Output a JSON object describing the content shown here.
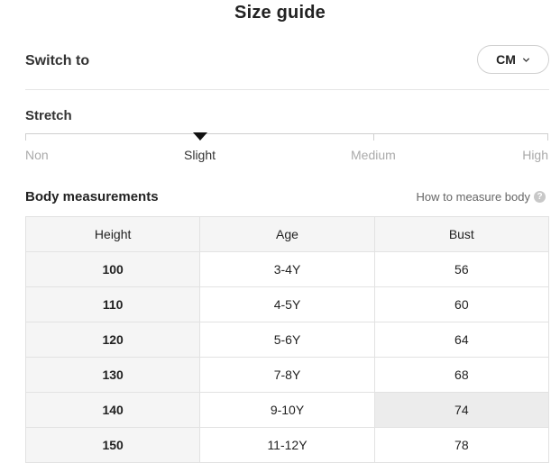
{
  "title": "Size guide",
  "switch": {
    "label": "Switch to",
    "unit": "CM"
  },
  "stretch": {
    "label": "Stretch",
    "levels": [
      "Non",
      "Slight",
      "Medium",
      "High"
    ],
    "selected": "Slight"
  },
  "body": {
    "label": "Body measurements",
    "how_link": "How to measure body",
    "help_glyph": "?"
  },
  "table": {
    "headers": [
      "Height",
      "Age",
      "Bust"
    ],
    "rows": [
      [
        "100",
        "3-4Y",
        "56"
      ],
      [
        "110",
        "4-5Y",
        "60"
      ],
      [
        "120",
        "5-6Y",
        "64"
      ],
      [
        "130",
        "7-8Y",
        "68"
      ],
      [
        "140",
        "9-10Y",
        "74"
      ],
      [
        "150",
        "11-12Y",
        "78"
      ]
    ],
    "highlighted_cell": {
      "row": 4,
      "col": 2
    }
  },
  "colors": {
    "highlight": "#ececec",
    "header_bg": "#f5f5f5",
    "pointer": "#111111"
  },
  "icons": {
    "unit_dropdown": "chevron-down-icon",
    "help": "help-circle-icon",
    "stretch_marker": "triangle-pointer-icon"
  }
}
